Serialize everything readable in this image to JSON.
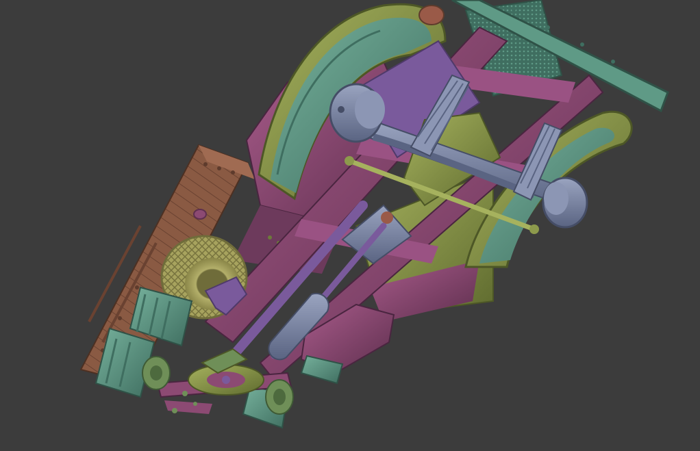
{
  "viewport": {
    "background": "#3c3c3c",
    "palette": {
      "teal": "#5f9a86",
      "teal_dark": "#3f6e60",
      "olive": "#8d9a4c",
      "olive_dark": "#5f6b2f",
      "magenta": "#8c4a73",
      "magenta_dark": "#5e2f4e",
      "purple": "#7a5a9c",
      "slate": "#7f8aa8",
      "slate_dark": "#5a6482",
      "brown": "#8a5a43",
      "brown_dark": "#5e3b2c",
      "tire": "#a7a35e",
      "tire_dark": "#6f6c3a"
    }
  }
}
